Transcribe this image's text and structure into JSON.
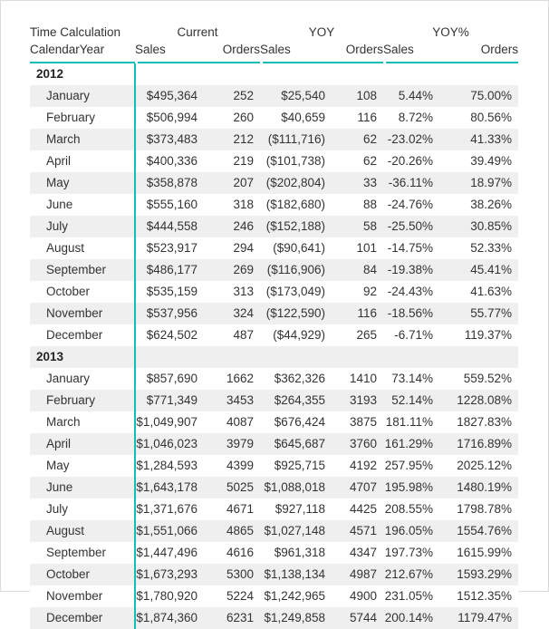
{
  "header": {
    "row_label_group": "Time Calculation",
    "row_label_field": "CalendarYear",
    "groups": [
      {
        "name": "Current",
        "measures": [
          "Sales",
          "Orders"
        ]
      },
      {
        "name": "YOY",
        "measures": [
          "Sales",
          "Orders"
        ]
      },
      {
        "name": "YOY%",
        "measures": [
          "Sales",
          "Orders"
        ]
      }
    ],
    "accent_color": "#13bcb4",
    "text_color": "#333333",
    "alt_row_color": "#efefef"
  },
  "columns": [
    "CalendarYear",
    "Current Sales",
    "Current Orders",
    "YOY Sales",
    "YOY Orders",
    "YOY% Sales",
    "YOY% Orders"
  ],
  "rows": [
    {
      "type": "year",
      "label": "2012",
      "cells": [
        "",
        "",
        "",
        "",
        "",
        ""
      ]
    },
    {
      "type": "month",
      "label": "January",
      "cells": [
        "$495,364",
        "252",
        "$25,540",
        "108",
        "5.44%",
        "75.00%"
      ]
    },
    {
      "type": "month",
      "label": "February",
      "cells": [
        "$506,994",
        "260",
        "$40,659",
        "116",
        "8.72%",
        "80.56%"
      ]
    },
    {
      "type": "month",
      "label": "March",
      "cells": [
        "$373,483",
        "212",
        "($111,716)",
        "62",
        "-23.02%",
        "41.33%"
      ]
    },
    {
      "type": "month",
      "label": "April",
      "cells": [
        "$400,336",
        "219",
        "($101,738)",
        "62",
        "-20.26%",
        "39.49%"
      ]
    },
    {
      "type": "month",
      "label": "May",
      "cells": [
        "$358,878",
        "207",
        "($202,804)",
        "33",
        "-36.11%",
        "18.97%"
      ]
    },
    {
      "type": "month",
      "label": "June",
      "cells": [
        "$555,160",
        "318",
        "($182,680)",
        "88",
        "-24.76%",
        "38.26%"
      ]
    },
    {
      "type": "month",
      "label": "July",
      "cells": [
        "$444,558",
        "246",
        "($152,188)",
        "58",
        "-25.50%",
        "30.85%"
      ]
    },
    {
      "type": "month",
      "label": "August",
      "cells": [
        "$523,917",
        "294",
        "($90,641)",
        "101",
        "-14.75%",
        "52.33%"
      ]
    },
    {
      "type": "month",
      "label": "September",
      "cells": [
        "$486,177",
        "269",
        "($116,906)",
        "84",
        "-19.38%",
        "45.41%"
      ]
    },
    {
      "type": "month",
      "label": "October",
      "cells": [
        "$535,159",
        "313",
        "($173,049)",
        "92",
        "-24.43%",
        "41.63%"
      ]
    },
    {
      "type": "month",
      "label": "November",
      "cells": [
        "$537,956",
        "324",
        "($122,590)",
        "116",
        "-18.56%",
        "55.77%"
      ]
    },
    {
      "type": "month",
      "label": "December",
      "cells": [
        "$624,502",
        "487",
        "($44,929)",
        "265",
        "-6.71%",
        "119.37%"
      ]
    },
    {
      "type": "year",
      "label": "2013",
      "cells": [
        "",
        "",
        "",
        "",
        "",
        ""
      ]
    },
    {
      "type": "month",
      "label": "January",
      "cells": [
        "$857,690",
        "1662",
        "$362,326",
        "1410",
        "73.14%",
        "559.52%"
      ]
    },
    {
      "type": "month",
      "label": "February",
      "cells": [
        "$771,349",
        "3453",
        "$264,355",
        "3193",
        "52.14%",
        "1228.08%"
      ]
    },
    {
      "type": "month",
      "label": "March",
      "cells": [
        "$1,049,907",
        "4087",
        "$676,424",
        "3875",
        "181.11%",
        "1827.83%"
      ]
    },
    {
      "type": "month",
      "label": "April",
      "cells": [
        "$1,046,023",
        "3979",
        "$645,687",
        "3760",
        "161.29%",
        "1716.89%"
      ]
    },
    {
      "type": "month",
      "label": "May",
      "cells": [
        "$1,284,593",
        "4399",
        "$925,715",
        "4192",
        "257.95%",
        "2025.12%"
      ]
    },
    {
      "type": "month",
      "label": "June",
      "cells": [
        "$1,643,178",
        "5025",
        "$1,088,018",
        "4707",
        "195.98%",
        "1480.19%"
      ]
    },
    {
      "type": "month",
      "label": "July",
      "cells": [
        "$1,371,676",
        "4671",
        "$927,118",
        "4425",
        "208.55%",
        "1798.78%"
      ]
    },
    {
      "type": "month",
      "label": "August",
      "cells": [
        "$1,551,066",
        "4865",
        "$1,027,148",
        "4571",
        "196.05%",
        "1554.76%"
      ]
    },
    {
      "type": "month",
      "label": "September",
      "cells": [
        "$1,447,496",
        "4616",
        "$961,318",
        "4347",
        "197.73%",
        "1615.99%"
      ]
    },
    {
      "type": "month",
      "label": "October",
      "cells": [
        "$1,673,293",
        "5300",
        "$1,138,134",
        "4987",
        "212.67%",
        "1593.29%"
      ]
    },
    {
      "type": "month",
      "label": "November",
      "cells": [
        "$1,780,920",
        "5224",
        "$1,242,965",
        "4900",
        "231.05%",
        "1512.35%"
      ]
    },
    {
      "type": "month",
      "label": "December",
      "cells": [
        "$1,874,360",
        "6231",
        "$1,249,858",
        "5744",
        "200.14%",
        "1179.47%"
      ]
    }
  ]
}
